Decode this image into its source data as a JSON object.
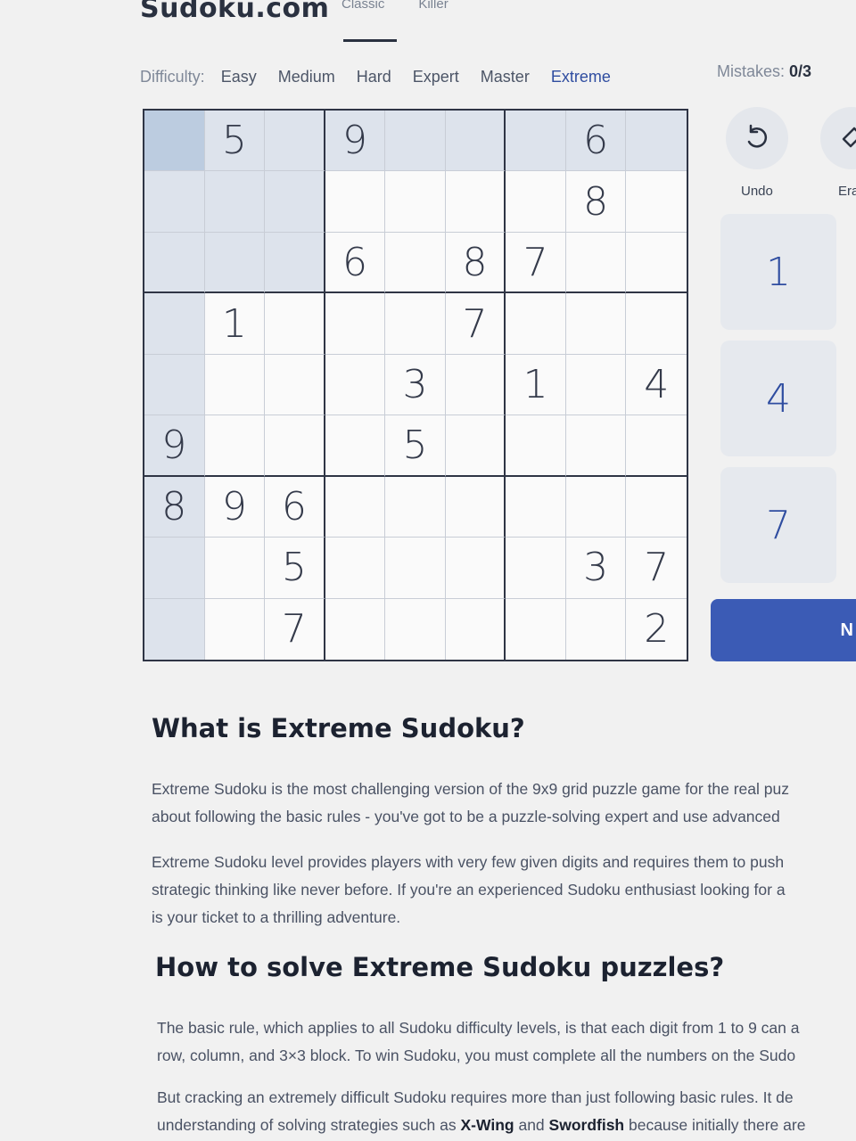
{
  "site": {
    "logo": "Sudoku.com"
  },
  "modes": [
    {
      "label": "Classic",
      "active": true
    },
    {
      "label": "Killer",
      "active": false
    }
  ],
  "difficulty": {
    "label": "Difficulty:",
    "options": [
      "Easy",
      "Medium",
      "Hard",
      "Expert",
      "Master",
      "Extreme"
    ],
    "selected": "Extreme"
  },
  "mistakes": {
    "label": "Mistakes:",
    "value": "0/3"
  },
  "board": {
    "selected_cell": {
      "row": 0,
      "col": 0
    },
    "rows": [
      [
        "",
        "5",
        "",
        "9",
        "",
        "",
        "",
        "6",
        ""
      ],
      [
        "",
        "",
        "",
        "",
        "",
        "",
        "",
        "8",
        ""
      ],
      [
        "",
        "",
        "",
        "6",
        "",
        "8",
        "7",
        "",
        ""
      ],
      [
        "",
        "1",
        "",
        "",
        "",
        "7",
        "",
        "",
        ""
      ],
      [
        "",
        "",
        "",
        "",
        "3",
        "",
        "1",
        "",
        "4"
      ],
      [
        "9",
        "",
        "",
        "",
        "5",
        "",
        "",
        "",
        ""
      ],
      [
        "8",
        "9",
        "6",
        "",
        "",
        "",
        "",
        "",
        ""
      ],
      [
        "",
        "",
        "5",
        "",
        "",
        "",
        "",
        "3",
        "7"
      ],
      [
        "",
        "",
        "7",
        "",
        "",
        "",
        "",
        "",
        "2"
      ]
    ]
  },
  "tools": {
    "undo": {
      "label": "Undo",
      "icon": "undo-icon"
    },
    "erase": {
      "label": "Era",
      "icon": "eraser-icon"
    }
  },
  "numpad": [
    "1",
    "4",
    "7"
  ],
  "new_game_button": {
    "label": "N"
  },
  "article": {
    "heading1": "What is Extreme Sudoku?",
    "p1_line1": "Extreme Sudoku is the most challenging version of the 9x9 grid puzzle game for the real puz",
    "p1_line2": "about following the basic rules - you've got to be a puzzle-solving expert and use advanced",
    "p2_line1": "Extreme Sudoku level provides players with very few given digits and requires them to push",
    "p2_line2": "strategic thinking like never before. If you're an experienced Sudoku enthusiast looking for a",
    "p2_line3": "is your ticket to a thrilling adventure.",
    "heading2": "How to solve Extreme Sudoku puzzles?",
    "p3_line1": "The basic rule, which applies to all Sudoku difficulty levels, is that each digit from 1 to 9 can a",
    "p3_line2": "row, column, and 3×3 block. To win Sudoku, you must complete all the numbers on the Sudo",
    "p4_line1": "But cracking an extremely difficult Sudoku requires more than just following basic rules. It de",
    "p4_pre": "understanding of solving strategies such as ",
    "p4_bold1": "X-Wing",
    "p4_mid": " and ",
    "p4_bold2": "Swordfish",
    "p4_post": " because initially there are"
  }
}
